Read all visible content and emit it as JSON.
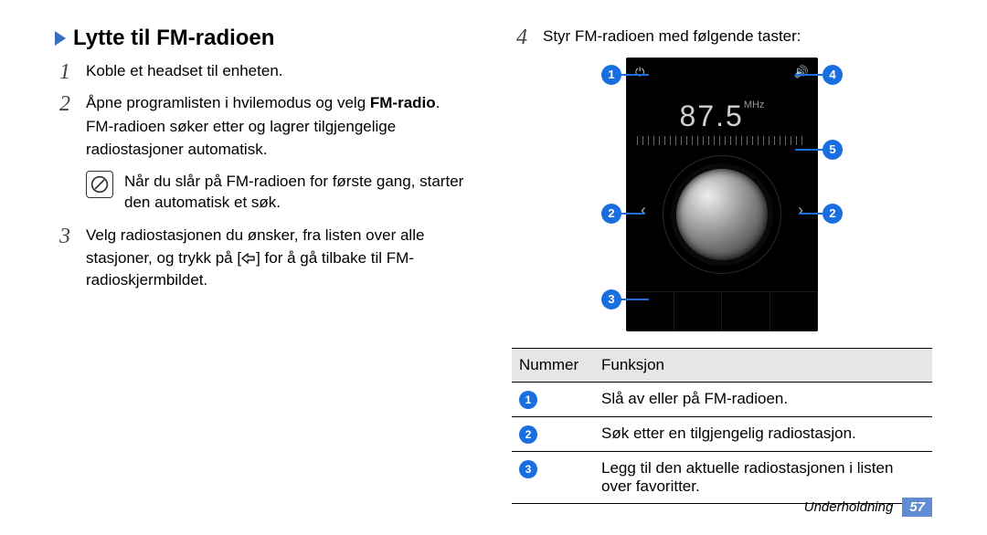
{
  "section": {
    "title": "Lytte til FM-radioen"
  },
  "steps": {
    "s1": {
      "num": "1",
      "text": "Koble et headset til enheten."
    },
    "s2": {
      "num": "2",
      "line1_pre": "Åpne programlisten i hvilemodus og velg ",
      "line1_bold": "FM-radio",
      "line1_post": ".",
      "line2": "FM-radioen søker etter og lagrer tilgjengelige radiostasjoner automatisk."
    },
    "note": "Når du slår på FM-radioen for første gang, starter den automatisk et søk.",
    "s3": {
      "num": "3",
      "text": "Velg radiostasjonen du ønsker, fra listen over alle stasjoner, og trykk på [    ] for å gå tilbake til FM-radioskjermbildet."
    },
    "s4": {
      "num": "4",
      "text": "Styr FM-radioen med følgende taster:"
    }
  },
  "radio": {
    "frequency": "87.5",
    "unit": "MHz"
  },
  "callouts": {
    "c1": "1",
    "c2": "2",
    "c3": "3",
    "c4": "4",
    "c5": "5"
  },
  "table": {
    "head_num": "Nummer",
    "head_func": "Funksjon",
    "rows": [
      {
        "n": "1",
        "f": "Slå av eller på FM-radioen."
      },
      {
        "n": "2",
        "f": "Søk etter en tilgjengelig radiostasjon."
      },
      {
        "n": "3",
        "f": "Legg til den aktuelle radiostasjonen i listen over favoritter."
      }
    ]
  },
  "footer": {
    "section": "Underholdning",
    "page": "57"
  }
}
